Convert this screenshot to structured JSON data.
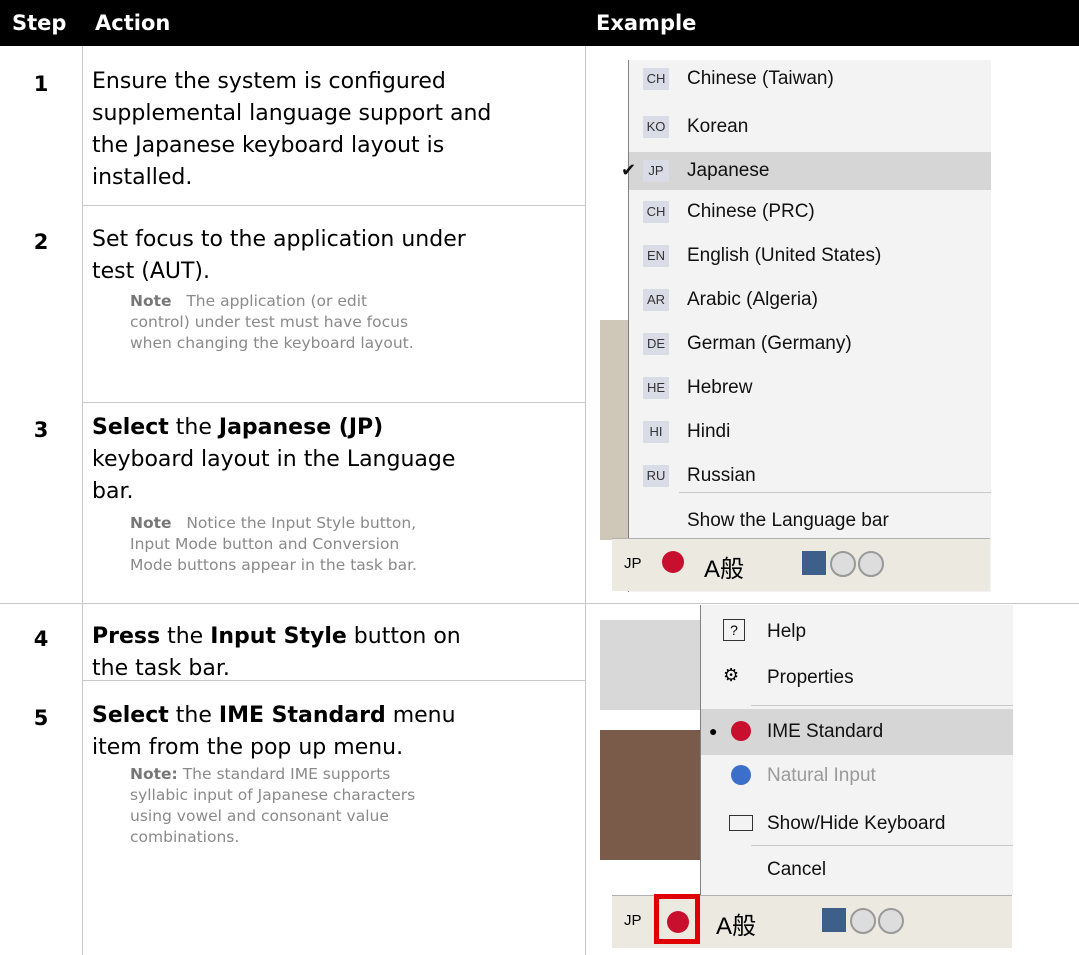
{
  "header": {
    "step": "Step",
    "action": "Action",
    "example": "Example"
  },
  "steps": [
    {
      "num": "1",
      "lines": [
        "Ensure the system is configured",
        "supplemental language support and",
        "the Japanese keyboard layout is",
        "installed."
      ]
    },
    {
      "num": "2",
      "lines": [
        "Set focus to the application under",
        "test (AUT)."
      ],
      "note_label": "Note",
      "note_lines": [
        "The application (or edit",
        "control) under test must have focus",
        "when changing the keyboard layout."
      ]
    },
    {
      "num": "3",
      "p1": "Select",
      "p2": " the ",
      "p3": "Japanese (JP)",
      "lines": [
        "keyboard layout in the Language",
        "bar."
      ],
      "note_label": "Note",
      "note_lines": [
        "Notice the Input Style button,",
        "Input Mode button and Conversion",
        "Mode buttons appear in the task bar."
      ]
    },
    {
      "num": "4",
      "p1": "Press",
      "p2": " the ",
      "p3": "Input Style",
      "p4": " button on",
      "lines": [
        "the task bar."
      ]
    },
    {
      "num": "5",
      "p1": "Select",
      "p2": " the ",
      "p3": "IME Standard",
      "p4": " menu",
      "lines": [
        "item from the pop up menu."
      ],
      "note_label": "Note:",
      "note_lines": [
        "The standard IME supports",
        "syllabic input of Japanese characters",
        "using vowel and consonant value",
        "combinations."
      ]
    }
  ],
  "language_menu": {
    "items": [
      {
        "code": "CH",
        "label": "Chinese (Taiwan)"
      },
      {
        "code": "KO",
        "label": "Korean"
      },
      {
        "code": "JP",
        "label": "Japanese",
        "checked": true
      },
      {
        "code": "CH",
        "label": "Chinese (PRC)"
      },
      {
        "code": "EN",
        "label": "English (United States)"
      },
      {
        "code": "AR",
        "label": "Arabic (Algeria)"
      },
      {
        "code": "DE",
        "label": "German (Germany)"
      },
      {
        "code": "HE",
        "label": "Hebrew"
      },
      {
        "code": "HI",
        "label": "Hindi"
      },
      {
        "code": "RU",
        "label": "Russian"
      }
    ],
    "show_bar": "Show the Language bar"
  },
  "taskbar": {
    "lang": "JP",
    "mode": "A般"
  },
  "input_style_menu": {
    "items": [
      {
        "label": "Help",
        "icon": "help-icon"
      },
      {
        "label": "Properties",
        "icon": "properties-icon"
      },
      {
        "label": "IME Standard",
        "icon": "ime-ball-icon",
        "selected": true
      },
      {
        "label": "Natural Input",
        "icon": "ime-ball-blue-icon",
        "disabled": true
      },
      {
        "label": "Show/Hide Keyboard",
        "icon": "keyboard-icon"
      },
      {
        "label": "Cancel",
        "icon": ""
      }
    ]
  }
}
